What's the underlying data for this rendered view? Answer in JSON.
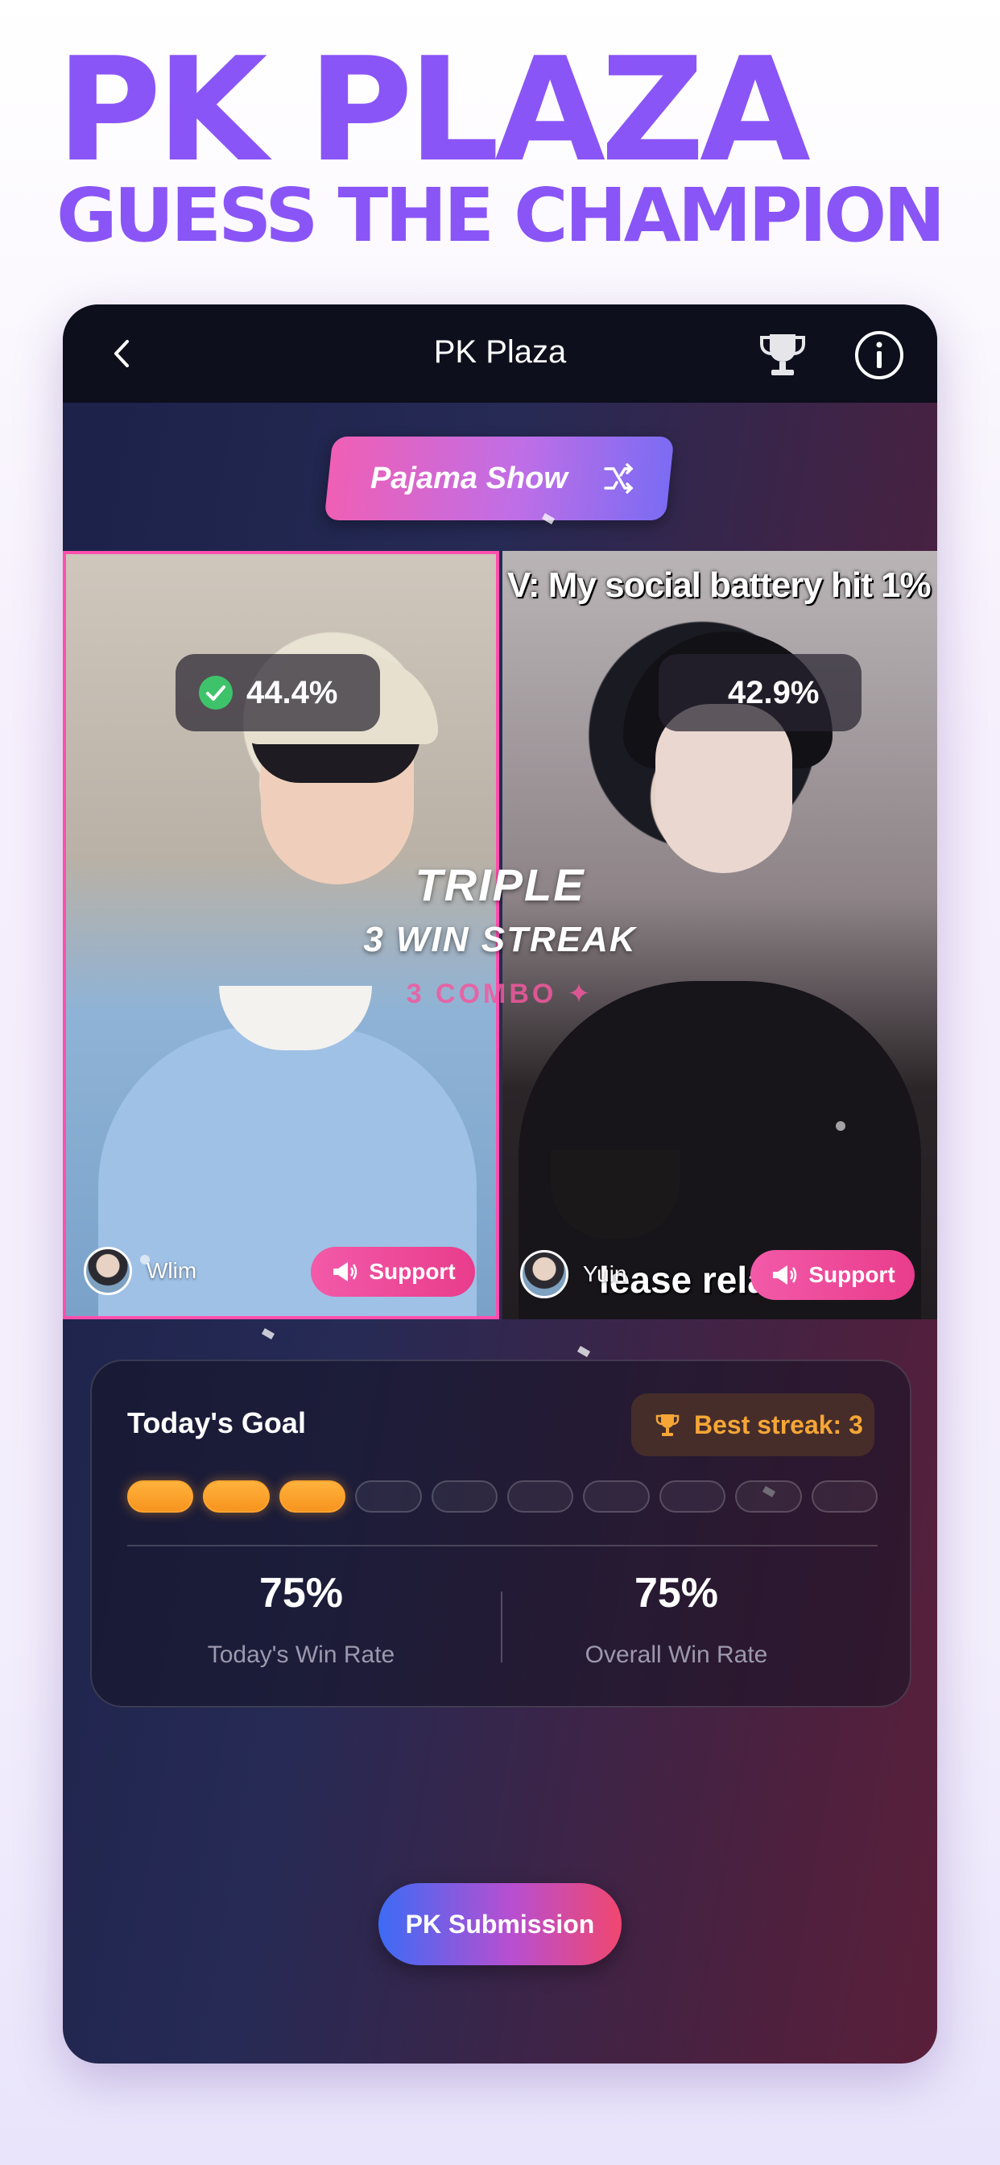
{
  "promo": {
    "title": "PK PLAZA",
    "subtitle": "GUESS THE CHAMPION"
  },
  "nav": {
    "title": "PK Plaza",
    "icons": [
      "chevron-left-icon",
      "trophy-icon",
      "info-icon"
    ]
  },
  "category": {
    "label": "Pajama Show",
    "icon": "shuffle-icon"
  },
  "battle": {
    "left": {
      "name": "Wlim",
      "percent": "44.4%",
      "selected": true,
      "support_label": "Support"
    },
    "right": {
      "name": "Yuin",
      "percent": "42.9%",
      "caption_top": "V: My social battery hit 1%",
      "caption_bottom": "lease rela",
      "support_label": "Support"
    },
    "streak_line1": "TRIPLE",
    "streak_line2": "3 WIN STREAK",
    "combo": "3 COMBO ✦"
  },
  "goal": {
    "heading": "Today's Goal",
    "best_streak": "Best streak: 3",
    "progress": {
      "done": 3,
      "total": 10
    },
    "stats": [
      {
        "value": "75%",
        "label": "Today's Win Rate"
      },
      {
        "value": "75%",
        "label": "Overall Win Rate"
      }
    ]
  },
  "actions": {
    "submit_label": "PK Submission"
  },
  "colors": {
    "brand_purple": "#8a55f6",
    "support_pink": "#e93c8c",
    "streak_orange": "#f7941f"
  }
}
